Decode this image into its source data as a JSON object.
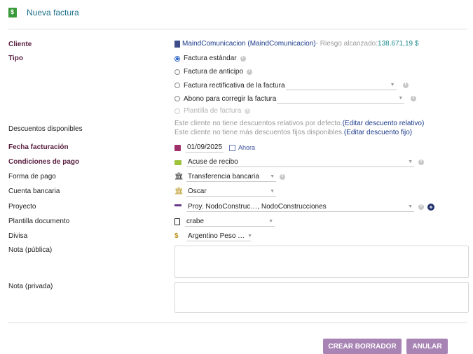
{
  "header": {
    "title": "Nueva factura"
  },
  "labels": {
    "cliente": "Cliente",
    "tipo": "Tipo",
    "descuentos": "Descuentos disponibles",
    "fecha": "Fecha facturación",
    "condiciones": "Condiciones de pago",
    "forma": "Forma de pago",
    "cuenta": "Cuenta bancaria",
    "proyecto": "Proyecto",
    "plantilla": "Plantilla documento",
    "divisa": "Divisa",
    "nota_publica": "Nota (pública)",
    "nota_privada": "Nota (privada)"
  },
  "cliente": {
    "name": "MaindComunicacion (MaindComunicacion)",
    "risk_label": " - Riesgo alcanzado: ",
    "risk_value": "138.671,19 $"
  },
  "tipo": {
    "options": [
      "Factura estándar",
      "Factura de anticipo",
      "Factura rectificativa de la factura",
      "Abono para corregir la factura",
      "Plantilla de factura"
    ]
  },
  "descuentos": {
    "line1_text": "Este cliente no tiene descuentos relativos por defecto. ",
    "line1_link": "(Editar descuento relativo)",
    "line2_text": "Este cliente no tiene más descuentos fijos disponibles. ",
    "line2_link": "(Editar descuento fijo)"
  },
  "fecha": {
    "value": "01/09/2025",
    "now_label": "Ahora"
  },
  "condiciones": {
    "value": "Acuse de recibo"
  },
  "forma": {
    "value": "Transferencia bancaria"
  },
  "cuenta": {
    "value": "Oscar"
  },
  "proyecto": {
    "value": "Proy. NodoConstruc…, NodoConstrucciones"
  },
  "plantilla": {
    "value": "crabe"
  },
  "divisa": {
    "value": "Argentino Peso …"
  },
  "buttons": {
    "crear": "CREAR BORRADOR",
    "anular": "ANULAR"
  },
  "colors": {
    "accent": "#a884b4",
    "link": "#1a3a8a",
    "required_label": "#5a2041",
    "risk_value": "#1d8a8a"
  }
}
